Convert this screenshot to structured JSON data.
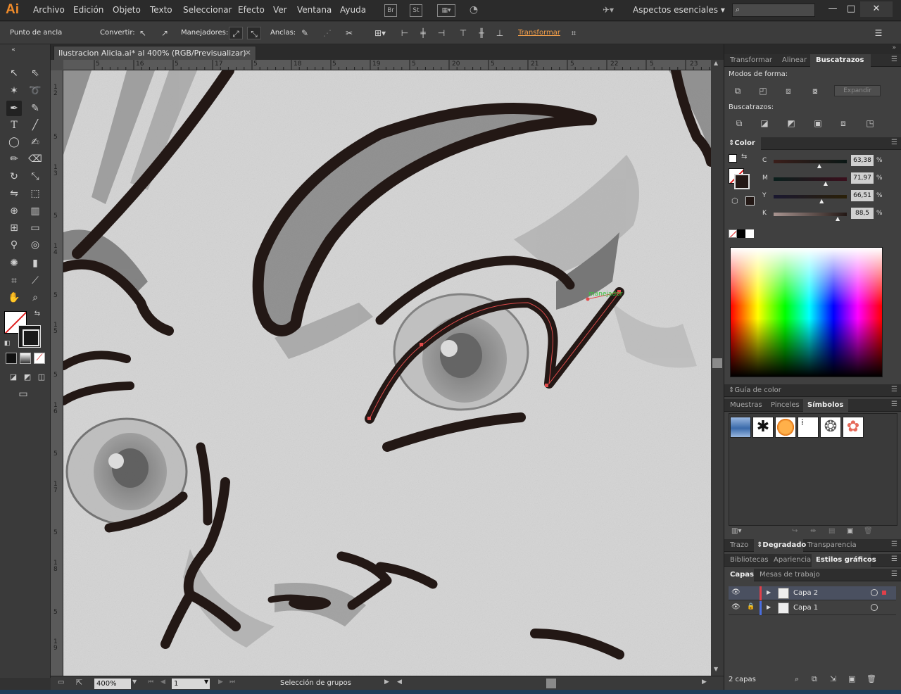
{
  "app": {
    "logo": "Ai",
    "menu": [
      "Archivo",
      "Edición",
      "Objeto",
      "Texto",
      "Seleccionar",
      "Efecto",
      "Ver",
      "Ventana",
      "Ayuda"
    ],
    "menu_icons": [
      "Br",
      "St"
    ],
    "workspace": "Aspectos esenciales",
    "window_controls": [
      "—",
      "□",
      "✕"
    ]
  },
  "control_bar": {
    "anchor_label": "Punto de ancla",
    "convert_label": "Convertir:",
    "handles_label": "Manejadores:",
    "anchors_label": "Anclas:",
    "transform_link": "Transformar"
  },
  "document": {
    "tab_title": "Ilustracion Alicia.ai* al 400% (RGB/Previsualizar)",
    "close": "×",
    "ruler_top": [
      "5",
      "16",
      "5",
      "17",
      "5",
      "18",
      "5",
      "19",
      "5",
      "20",
      "5",
      "21",
      "5",
      "22",
      "5",
      "23"
    ],
    "ruler_left": [
      "1\n2",
      "5",
      "1\n3",
      "5",
      "1\n4",
      "5",
      "1\n5",
      "5",
      "1\n6",
      "5",
      "1\n7",
      "5",
      "1\n8",
      "5",
      "1\n9"
    ],
    "tooltip": "manejador"
  },
  "status": {
    "zoom": "400%",
    "page": "1",
    "text": "Selección de grupos"
  },
  "panels": {
    "top_tabs": [
      "Transformar",
      "Alinear",
      "Buscatrazos"
    ],
    "shape_modes_label": "Modos de forma:",
    "expand_button": "Expandir",
    "pathfinders_label": "Buscatrazos:",
    "color_title": "Color",
    "color_sliders": [
      {
        "label": "C",
        "value": "63,38",
        "pct": 63.38
      },
      {
        "label": "M",
        "value": "71,97",
        "pct": 71.97
      },
      {
        "label": "Y",
        "value": "66,51",
        "pct": 66.51
      },
      {
        "label": "K",
        "value": "88,5",
        "pct": 88.5
      }
    ],
    "percent": "%",
    "color_guide_tab": "Guía de color",
    "swatch_tabs": [
      "Muestras",
      "Pinceles",
      "Símbolos"
    ],
    "trazo_tabs": [
      "Trazo",
      "Degradado",
      "Transparencia"
    ],
    "style_tabs": [
      "Bibliotecas",
      "Apariencia",
      "Estilos gráficos"
    ],
    "layer_tabs": [
      "Capas",
      "Mesas de trabajo"
    ],
    "layers": [
      {
        "name": "Capa 2",
        "color": "#e0404a",
        "locked": false,
        "selected": true
      },
      {
        "name": "Capa 1",
        "color": "#4a6ee0",
        "locked": true,
        "selected": false
      }
    ],
    "layers_count": "2 capas"
  },
  "colors": {
    "accent": "#f08b2a",
    "stroke_fill": "#231815",
    "selection_path": "#e04a4a"
  }
}
